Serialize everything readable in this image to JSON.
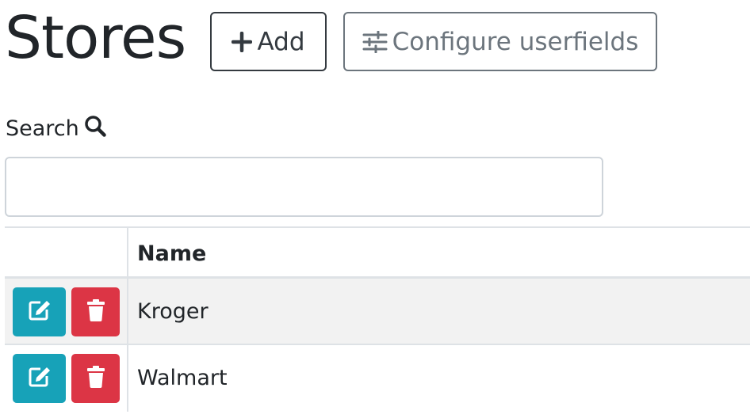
{
  "page": {
    "title": "Stores"
  },
  "toolbar": {
    "add_label": "Add",
    "add_icon": "plus-icon",
    "configure_label": "Configure userfields",
    "configure_icon": "sliders-icon"
  },
  "search": {
    "label": "Search",
    "icon": "search-icon",
    "value": "",
    "placeholder": ""
  },
  "table": {
    "columns": [
      "",
      "Name"
    ],
    "rows": [
      {
        "name": "Kroger"
      },
      {
        "name": "Walmart"
      }
    ]
  },
  "colors": {
    "edit_button": "#17a2b8",
    "delete_button": "#dc3545",
    "add_button_border": "#343a40",
    "configure_button_border": "#6c757d"
  }
}
